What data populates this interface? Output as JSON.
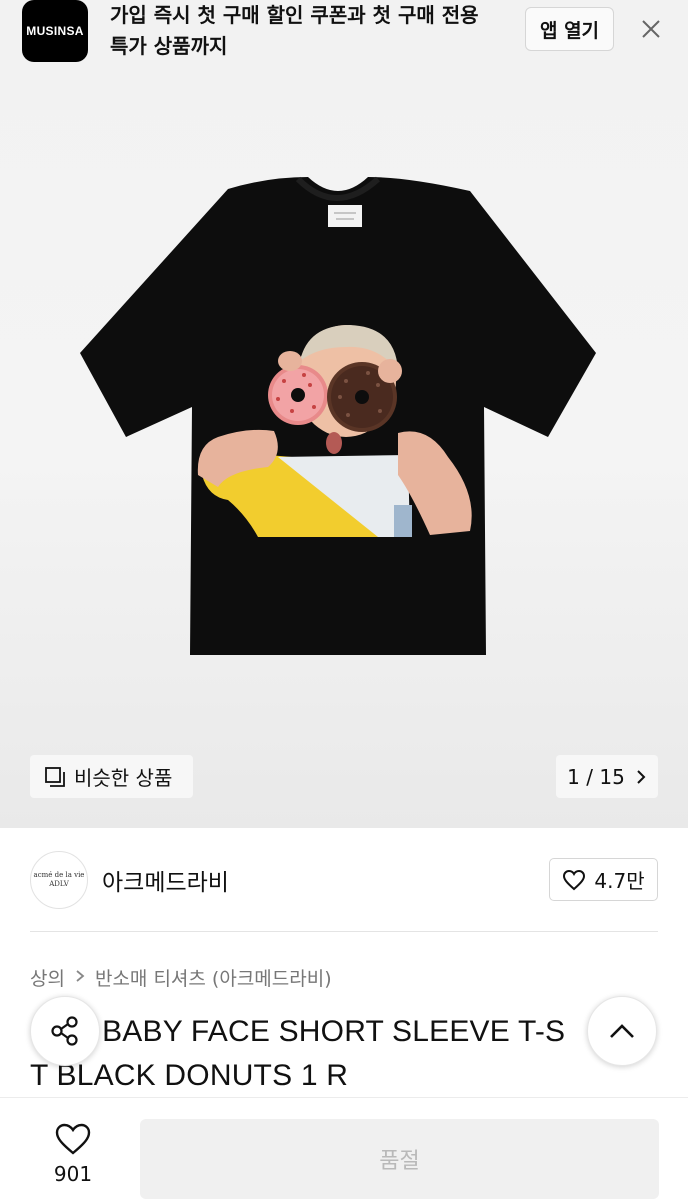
{
  "banner": {
    "logo_text": "MUSINSA",
    "message": "가입 즉시 첫 구매 할인 쿠폰과 첫 구매 전용 특가 상품까지",
    "open_app_label": "앱 열기",
    "close_icon": "close-icon"
  },
  "gallery": {
    "similar_label": "비슷한 상품",
    "page_indicator": "1 / 15",
    "image_alt": "black t-shirt with child holding donuts print"
  },
  "brand": {
    "logo_line1": "acmé de la vie",
    "logo_line2": "ADLV",
    "name": "아크메드라비",
    "like_count": "4.7만"
  },
  "breadcrumb": {
    "category": "상의",
    "subcategory": "반소매 티셔츠 (아크메드라비)"
  },
  "product": {
    "title_line1": "/ BABY FACE SHORT SLEEVE T-S",
    "title_line2": "T BLACK DONUTS 1 R"
  },
  "bottom_bar": {
    "wish_count": "901",
    "soldout_label": "품절"
  },
  "colors": {
    "accent": "#000000",
    "muted_text": "#777777",
    "soldout_text": "#b9b9b9"
  }
}
